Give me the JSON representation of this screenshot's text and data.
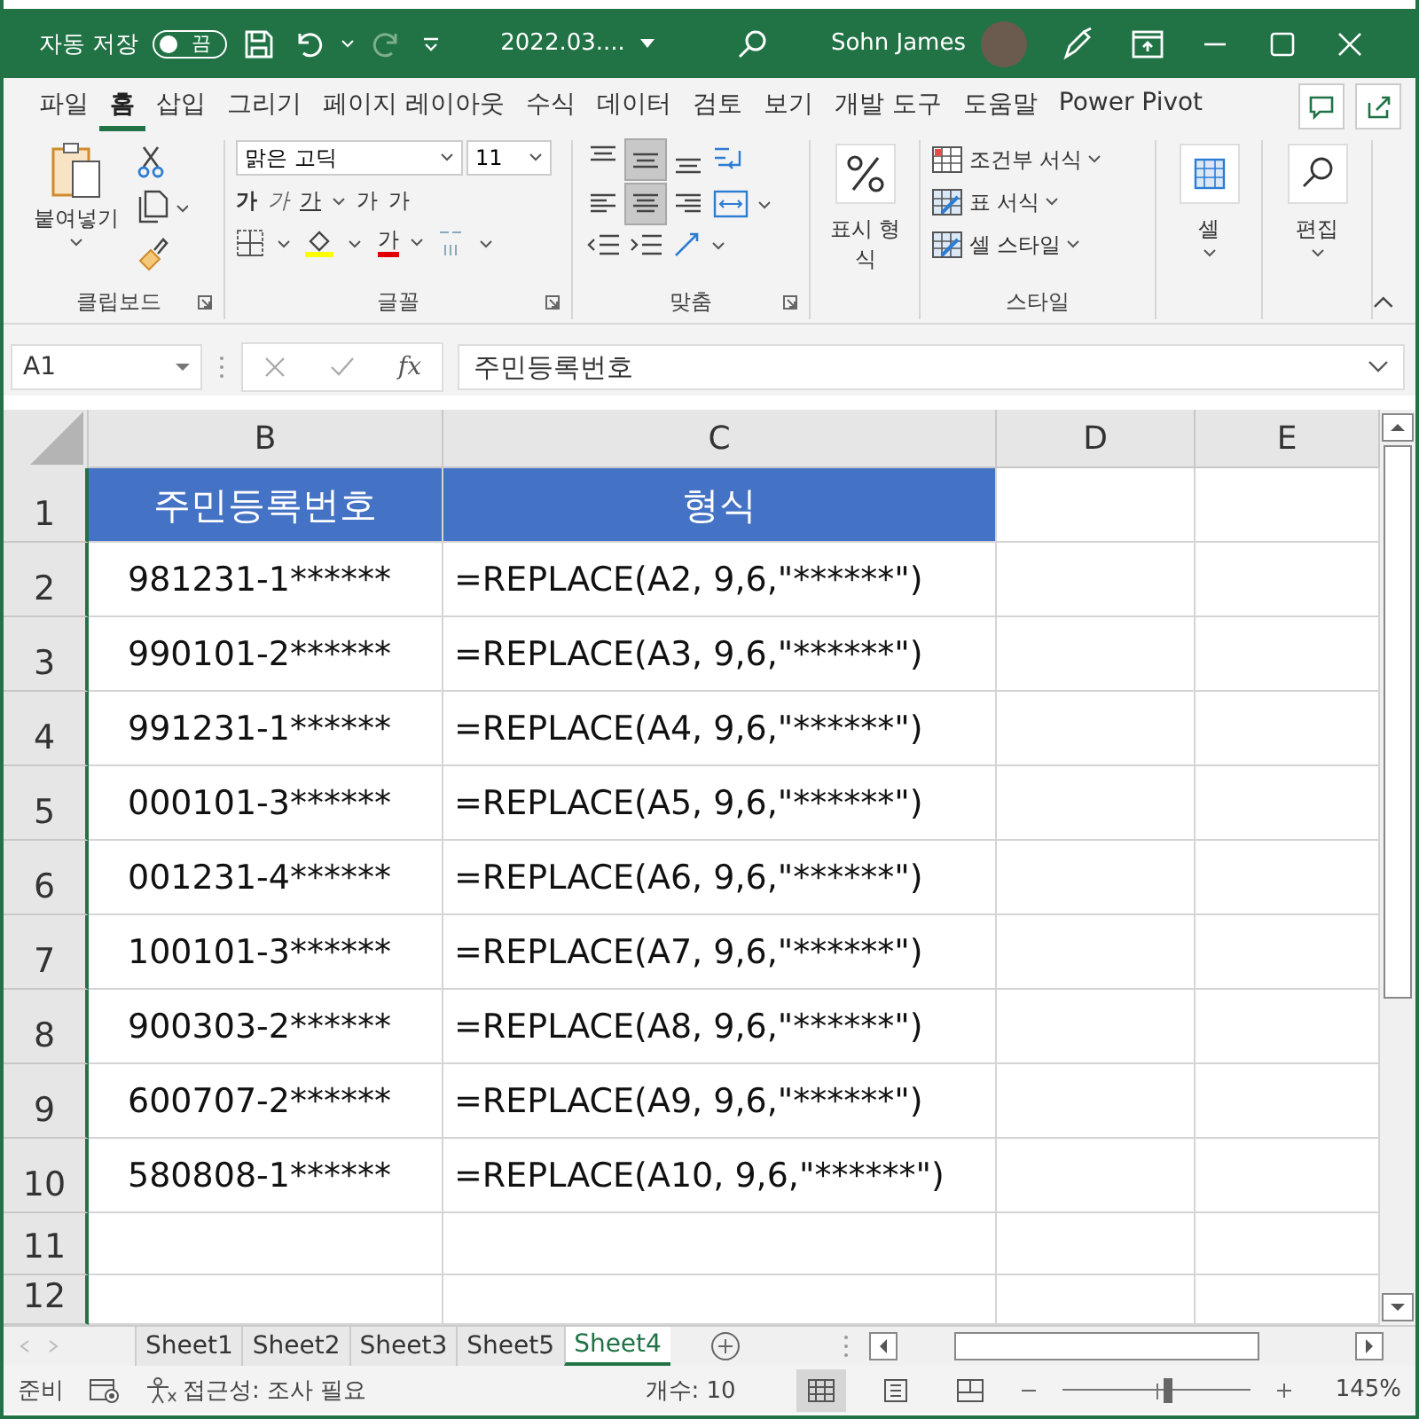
{
  "title_bar": {
    "autosave_label": "자동 저장",
    "autosave": {
      "on": false,
      "label": "끔"
    },
    "filename": "2022.03....",
    "user_name": "Sohn James"
  },
  "menu_tabs": [
    {
      "label": "파일",
      "selected": false
    },
    {
      "label": "홈",
      "selected": true
    },
    {
      "label": "삽입",
      "selected": false
    },
    {
      "label": "그리기",
      "selected": false
    },
    {
      "label": "페이지 레이아웃",
      "selected": false
    },
    {
      "label": "수식",
      "selected": false
    },
    {
      "label": "데이터",
      "selected": false
    },
    {
      "label": "검토",
      "selected": false
    },
    {
      "label": "보기",
      "selected": false
    },
    {
      "label": "개발 도구",
      "selected": false
    },
    {
      "label": "도움말",
      "selected": false
    },
    {
      "label": "Power Pivot",
      "selected": false
    }
  ],
  "ribbon": {
    "clipboard": {
      "paste": "붙여넣기",
      "label": "클립보드"
    },
    "font": {
      "font_name": "맑은 고딕",
      "font_size": "11",
      "bold": "가",
      "italic": "가",
      "underline": "가",
      "grow": "가",
      "shrink": "가",
      "font_color": "가",
      "label": "글꼴"
    },
    "alignment": {
      "vertical": [
        {
          "selected": false
        },
        {
          "selected": true
        },
        {
          "selected": false
        }
      ],
      "horizontal": [
        {
          "selected": false
        },
        {
          "selected": true
        },
        {
          "selected": false
        }
      ],
      "label": "맞춤"
    },
    "number": {
      "button": "표시 형식"
    },
    "styles": {
      "items": [
        "조건부 서식",
        "표 서식",
        "셀 스타일"
      ],
      "label": "스타일"
    },
    "cells": {
      "button": "셀"
    },
    "editing": {
      "button": "편집"
    }
  },
  "formula_bar": {
    "name_box": "A1",
    "fx": "fx",
    "content": "주민등록번호"
  },
  "sheet": {
    "columns": [
      "B",
      "C",
      "D",
      "E"
    ],
    "rows": [
      {
        "number": "1",
        "kind": "header",
        "cells": [
          "주민등록번호",
          "형식"
        ]
      },
      {
        "number": "2",
        "kind": "data",
        "cells": [
          "981231-1******",
          "=REPLACE(A2, 9,6,\"******\")"
        ]
      },
      {
        "number": "3",
        "kind": "data",
        "cells": [
          "990101-2******",
          "=REPLACE(A3, 9,6,\"******\")"
        ]
      },
      {
        "number": "4",
        "kind": "data",
        "cells": [
          "991231-1******",
          "=REPLACE(A4, 9,6,\"******\")"
        ]
      },
      {
        "number": "5",
        "kind": "data",
        "cells": [
          "000101-3******",
          "=REPLACE(A5, 9,6,\"******\")"
        ]
      },
      {
        "number": "6",
        "kind": "data",
        "cells": [
          "001231-4******",
          "=REPLACE(A6, 9,6,\"******\")"
        ]
      },
      {
        "number": "7",
        "kind": "data",
        "cells": [
          "100101-3******",
          "=REPLACE(A7, 9,6,\"******\")"
        ]
      },
      {
        "number": "8",
        "kind": "data",
        "cells": [
          "900303-2******",
          "=REPLACE(A8, 9,6,\"******\")"
        ]
      },
      {
        "number": "9",
        "kind": "data",
        "cells": [
          "600707-2******",
          "=REPLACE(A9, 9,6,\"******\")"
        ]
      },
      {
        "number": "10",
        "kind": "data",
        "cells": [
          "580808-1******",
          "=REPLACE(A10, 9,6,\"******\")"
        ]
      },
      {
        "number": "11",
        "kind": "data",
        "cells": []
      },
      {
        "number": "12",
        "kind": "data",
        "cells": []
      }
    ]
  },
  "sheet_tabs": [
    {
      "label": "Sheet1",
      "selected": false
    },
    {
      "label": "Sheet2",
      "selected": false
    },
    {
      "label": "Sheet3",
      "selected": false
    },
    {
      "label": "Sheet5",
      "selected": false
    },
    {
      "label": "Sheet4",
      "selected": true
    }
  ],
  "status_bar": {
    "ready": "준비",
    "accessibility": "접근성: 조사 필요",
    "count": "개수: 10",
    "views": [
      {
        "selected": true
      },
      {
        "selected": false
      },
      {
        "selected": false
      }
    ],
    "zoom": {
      "level": 0.57
    },
    "zoom_label": "145%"
  }
}
